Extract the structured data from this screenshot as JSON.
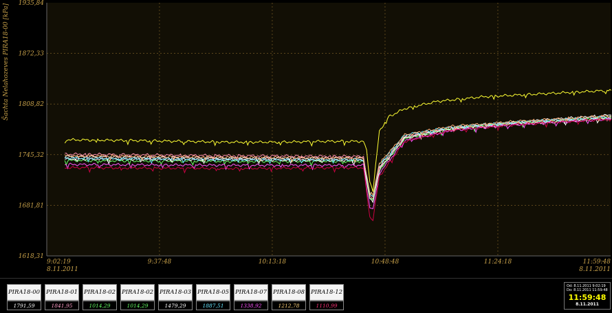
{
  "chart_data": {
    "type": "line",
    "ylabel": "Šachta Nelahozeves  PIRA18-00 [kPa]",
    "ylim": [
      1618.31,
      1935.84
    ],
    "yticks": [
      "1935,84",
      "1872,33",
      "1808,82",
      "1745,32",
      "1681,81",
      "1618,31"
    ],
    "ytick_values": [
      1935.84,
      1872.33,
      1808.82,
      1745.32,
      1681.81,
      1618.31
    ],
    "xlim": [
      "9:02:19",
      "11:59:48"
    ],
    "xticks": [
      {
        "time": "9:02:19",
        "date": "8.11.2011"
      },
      {
        "time": "9:37:48",
        "date": ""
      },
      {
        "time": "10:13:18",
        "date": ""
      },
      {
        "time": "10:48:48",
        "date": ""
      },
      {
        "time": "11:24:18",
        "date": ""
      },
      {
        "time": "11:59:48",
        "date": "8.11.2011"
      }
    ],
    "grid": true,
    "x_minutes_ref": "minutes after 9:02:19",
    "series": [
      {
        "name": "PIRA18-00",
        "color": "#ffff33",
        "x": [
          "9:08",
          "9:30",
          "9:45",
          "10:00",
          "10:15",
          "10:30",
          "10:42",
          "10:43",
          "10:44",
          "10:45",
          "10:47",
          "10:50",
          "10:55",
          "11:05",
          "11:20",
          "11:40",
          "12:00"
        ],
        "y": [
          1764,
          1763,
          1762,
          1761,
          1761,
          1762,
          1762,
          1750,
          1712,
          1700,
          1775,
          1793,
          1803,
          1812,
          1818,
          1822,
          1826
        ]
      },
      {
        "name": "PIRA18-01",
        "color": "#ffffff",
        "x": [
          "9:08",
          "10:00",
          "10:42",
          "10:44",
          "10:45",
          "10:47",
          "10:55",
          "11:10",
          "11:30",
          "12:00"
        ],
        "y": [
          1743,
          1741,
          1741,
          1696,
          1692,
          1730,
          1768,
          1779,
          1786,
          1795
        ]
      },
      {
        "name": "PIRA18-02",
        "color": "#ff8fb0",
        "x": [
          "9:08",
          "10:00",
          "10:42",
          "10:44",
          "10:45",
          "10:47",
          "10:55",
          "11:10",
          "11:30",
          "12:00"
        ],
        "y": [
          1746,
          1744,
          1743,
          1694,
          1690,
          1728,
          1767,
          1779,
          1785,
          1793
        ]
      },
      {
        "name": "PIRA18-03",
        "color": "#66ff66",
        "x": [
          "9:08",
          "10:00",
          "10:42",
          "10:44",
          "10:45",
          "10:47",
          "10:55",
          "11:10",
          "11:30",
          "12:00"
        ],
        "y": [
          1738,
          1737,
          1737,
          1692,
          1688,
          1726,
          1766,
          1778,
          1785,
          1792
        ]
      },
      {
        "name": "PIRA18-05",
        "color": "#ffffff",
        "x": [
          "9:08",
          "10:00",
          "10:42",
          "10:44",
          "10:45",
          "10:47",
          "10:55",
          "11:10",
          "11:30",
          "12:00"
        ],
        "y": [
          1740,
          1739,
          1738,
          1689,
          1686,
          1727,
          1766,
          1778,
          1784,
          1791
        ]
      },
      {
        "name": "PIRA18-07",
        "color": "#66e6ff",
        "x": [
          "9:08",
          "10:00",
          "10:42",
          "10:44",
          "10:45",
          "10:47",
          "10:55",
          "11:10",
          "11:30",
          "12:00"
        ],
        "y": [
          1741,
          1739,
          1739,
          1697,
          1694,
          1733,
          1770,
          1780,
          1786,
          1793
        ]
      },
      {
        "name": "PIRA18-08",
        "color": "#ff55ff",
        "x": [
          "9:08",
          "10:00",
          "10:42",
          "10:44",
          "10:45",
          "10:47",
          "10:55",
          "11:10",
          "11:30",
          "12:00"
        ],
        "y": [
          1733,
          1732,
          1732,
          1680,
          1676,
          1722,
          1763,
          1776,
          1783,
          1790
        ]
      },
      {
        "name": "PIRA18-12",
        "color": "#ffb07a",
        "x": [
          "9:08",
          "10:00",
          "10:42",
          "10:44",
          "10:45",
          "10:47",
          "10:55",
          "11:10",
          "11:30",
          "12:00"
        ],
        "y": [
          1744,
          1742,
          1741,
          1698,
          1695,
          1735,
          1770,
          1781,
          1787,
          1794
        ]
      },
      {
        "name": "",
        "color": "#cc0044",
        "x": [
          "9:08",
          "10:00",
          "10:42",
          "10:44",
          "10:45",
          "10:47",
          "10:55",
          "11:10",
          "11:30",
          "12:00"
        ],
        "y": [
          1729,
          1728,
          1729,
          1667,
          1664,
          1718,
          1762,
          1776,
          1783,
          1790
        ]
      }
    ]
  },
  "legend": [
    {
      "name": "PIRA18-00",
      "value": "1791,59",
      "value_color": "#ffffff"
    },
    {
      "name": "PIRA18-01",
      "value": "1841,95",
      "value_color": "#ff9ec8"
    },
    {
      "name": "PIRA18-02",
      "value": "1014,29",
      "value_color": "#66ff66"
    },
    {
      "name": "PIRA18-02",
      "value": "1014,29",
      "value_color": "#66ff66"
    },
    {
      "name": "PIRA18-03",
      "value": "1479,29",
      "value_color": "#ffffff"
    },
    {
      "name": "PIRA18-05",
      "value": "1887,51",
      "value_color": "#66e6ff"
    },
    {
      "name": "PIRA18-07",
      "value": "1338,92",
      "value_color": "#ff55ff"
    },
    {
      "name": "PIRA18-08",
      "value": "1212,78",
      "value_color": "#ffd27a"
    },
    {
      "name": "PIRA18-12",
      "value": "1110,99",
      "value_color": "#ff3377"
    }
  ],
  "time_range": {
    "from": "Od: 8.11.2011 9:02:19",
    "to": "Do: 8.11.2011 11:59:48",
    "clock": "11:59:48",
    "date": "8.11.2011"
  },
  "colors": {
    "background": "#000000",
    "plot_background": "#120f05",
    "grid": "#8a6a2a",
    "axis_text": "#c9a24a"
  }
}
